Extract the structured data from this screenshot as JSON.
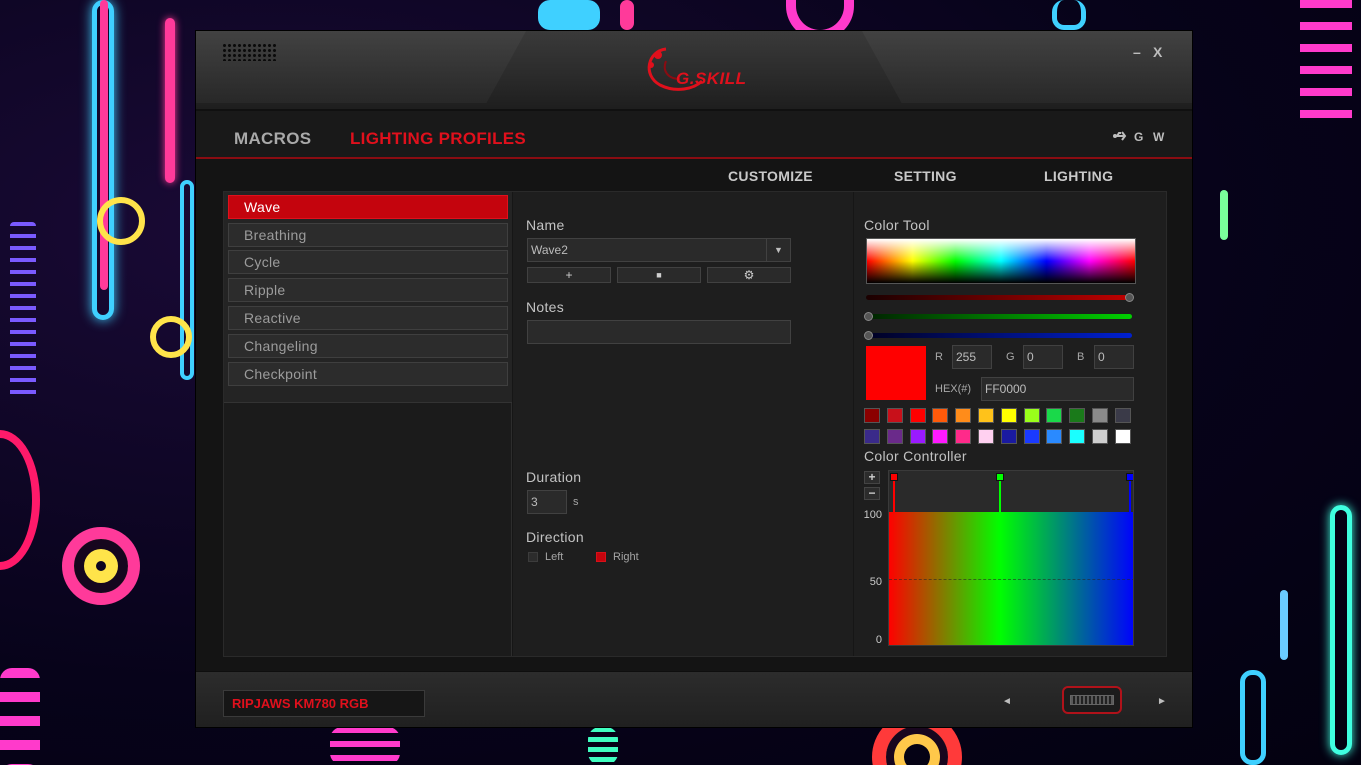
{
  "window": {
    "minimize_label": "–",
    "close_label": "X",
    "logo_text": "G.SKILL"
  },
  "nav": {
    "tabs": [
      {
        "label": "MACROS",
        "active": false
      },
      {
        "label": "LIGHTING PROFILES",
        "active": true
      }
    ],
    "icons": [
      "usb-icon"
    ],
    "lang": [
      "G",
      "W"
    ]
  },
  "subnav": {
    "items": [
      "CUSTOMIZE",
      "SETTING",
      "LIGHTING"
    ]
  },
  "effects": {
    "items": [
      "Wave",
      "Breathing",
      "Cycle",
      "Ripple",
      "Reactive",
      "Changeling",
      "Checkpoint"
    ],
    "selected": "Wave"
  },
  "profile": {
    "name_label": "Name",
    "name_value": "Wave2",
    "add_label": "+",
    "delete_label": "■",
    "settings_label": "⚙",
    "notes_label": "Notes",
    "notes_value": "",
    "duration_label": "Duration",
    "duration_value": "3",
    "duration_unit": "s",
    "direction_label": "Direction",
    "direction_left": "Left",
    "direction_right": "Right",
    "direction_selected": "Right"
  },
  "color_tool": {
    "label": "Color Tool",
    "r_label": "R",
    "r_value": "255",
    "g_label": "G",
    "g_value": "0",
    "b_label": "B",
    "b_value": "0",
    "hex_label": "HEX(#)",
    "hex_value": "FF0000",
    "current_color": "#ff0000",
    "swatches_row1": [
      "#8b0000",
      "#c8101a",
      "#ff0000",
      "#ff5a0a",
      "#ff8c1a",
      "#ffc21a",
      "#ffff00",
      "#9aff1a",
      "#1ad94a",
      "#1a7a1a",
      "#8a8a8a",
      "#3a3a48"
    ],
    "swatches_row2": [
      "#3a2a8a",
      "#6a2a8a",
      "#9a1aff",
      "#ff1aff",
      "#ff2a8a",
      "#ffd0f0",
      "#1a1aa0",
      "#1a3aff",
      "#2a8aff",
      "#1affff",
      "#cfcfcf",
      "#ffffff"
    ]
  },
  "color_controller": {
    "label": "Color Controller",
    "plus_label": "+",
    "minus_label": "−",
    "axis": [
      "100",
      "50",
      "0"
    ],
    "stops": [
      {
        "color": "#ff0000",
        "position": 0.0
      },
      {
        "color": "#00ff00",
        "position": 0.45
      },
      {
        "color": "#0000ff",
        "position": 1.0
      }
    ],
    "level": 100
  },
  "footer": {
    "device_name": "RIPJAWS KM780 RGB",
    "prev_label": "◄",
    "next_label": "►"
  }
}
